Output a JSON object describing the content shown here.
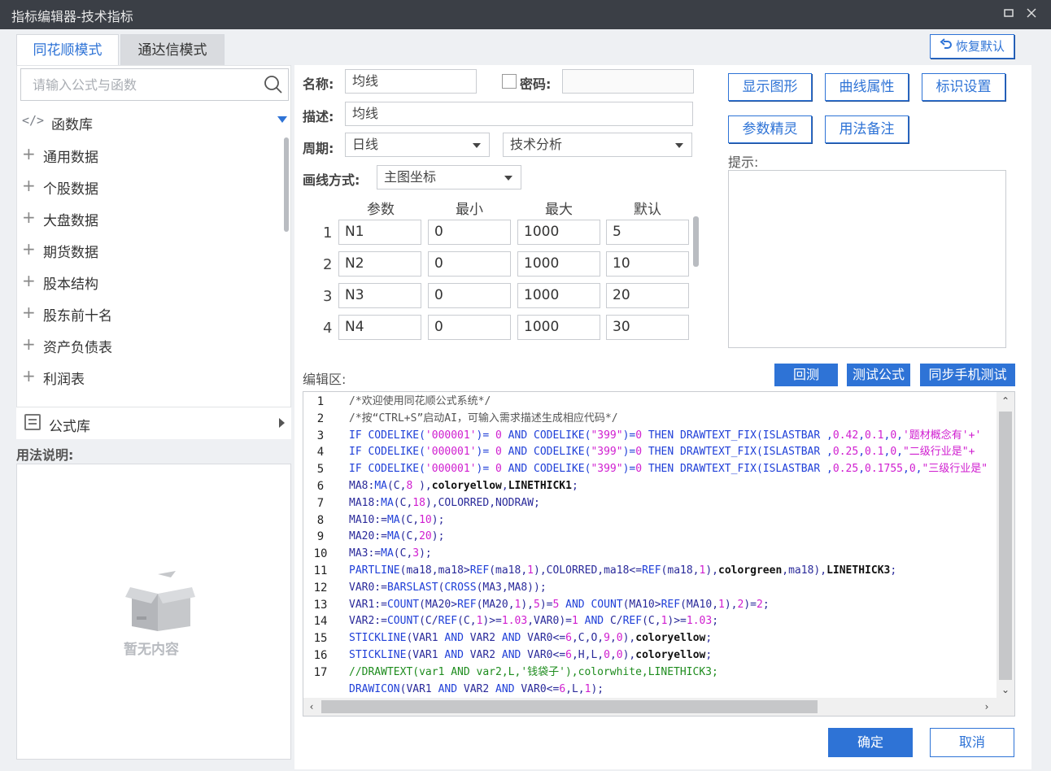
{
  "window": {
    "title": "指标编辑器-技术指标"
  },
  "tabs": {
    "ths": "同花顺模式",
    "tdx": "通达信模式"
  },
  "restore_default": "恢复默认",
  "search": {
    "placeholder": "请输入公式与函数"
  },
  "library": {
    "label": "函数库",
    "items": [
      "通用数据",
      "个股数据",
      "大盘数据",
      "期货数据",
      "股本结构",
      "股东前十名",
      "资产负债表",
      "利润表"
    ],
    "formula_lib": "公式库"
  },
  "usage": {
    "label": "用法说明:",
    "empty": "暂无内容"
  },
  "form": {
    "name_label": "名称:",
    "name_value": "均线",
    "password_label": "密码:",
    "desc_label": "描述:",
    "desc_value": "均线",
    "period_label": "周期:",
    "period_value": "日线",
    "category_value": "技术分析",
    "draw_label": "画线方式:",
    "draw_value": "主图坐标"
  },
  "params": {
    "headers": {
      "param": "参数",
      "min": "最小",
      "max": "最大",
      "default": "默认"
    },
    "rows": [
      {
        "num": "1",
        "name": "N1",
        "min": "0",
        "max": "1000",
        "def": "5"
      },
      {
        "num": "2",
        "name": "N2",
        "min": "0",
        "max": "1000",
        "def": "10"
      },
      {
        "num": "3",
        "name": "N3",
        "min": "0",
        "max": "1000",
        "def": "20"
      },
      {
        "num": "4",
        "name": "N4",
        "min": "0",
        "max": "1000",
        "def": "30"
      }
    ]
  },
  "buttons": {
    "show_graph": "显示图形",
    "curve_props": "曲线属性",
    "mark_settings": "标识设置",
    "param_wizard": "参数精灵",
    "usage_notes": "用法备注",
    "backtest": "回测",
    "test_formula": "测试公式",
    "sync_mobile": "同步手机测试",
    "ok": "确定",
    "cancel": "取消"
  },
  "hint_label": "提示:",
  "editor_label": "编辑区:",
  "editor": {
    "line_numbers": [
      "1",
      "2",
      "3",
      "4",
      "5",
      "6",
      "7",
      "8",
      "9",
      "10",
      "11",
      "12",
      "13",
      "14",
      "15",
      "16",
      "17"
    ],
    "lines": [
      [
        [
          "c-gray",
          "/*欢迎使用同花顺公式系统*/"
        ]
      ],
      [
        [
          "c-gray",
          "/*按“CTRL+S”启动AI，可输入需求描述生成相应代码*/"
        ]
      ],
      [
        [
          "c-blue",
          "IF CODELIKE("
        ],
        [
          "c-mag",
          "'000001'"
        ],
        [
          "c-blue",
          ")= "
        ],
        [
          "c-mag",
          "0"
        ],
        [
          "c-blue",
          " AND CODELIKE("
        ],
        [
          "c-mag",
          "\"399\""
        ],
        [
          "c-blue",
          ")="
        ],
        [
          "c-mag",
          "0"
        ],
        [
          "c-blue",
          " THEN DRAWTEXT_FIX(ISLASTBAR ,"
        ],
        [
          "c-mag",
          "0.42"
        ],
        [
          "c-blue",
          ","
        ],
        [
          "c-mag",
          "0.1"
        ],
        [
          "c-blue",
          ","
        ],
        [
          "c-mag",
          "0"
        ],
        [
          "c-blue",
          ","
        ],
        [
          "c-mag",
          "'题材概念有'+'"
        ]
      ],
      [
        [
          "c-blue",
          "IF CODELIKE("
        ],
        [
          "c-mag",
          "'000001'"
        ],
        [
          "c-blue",
          ")= "
        ],
        [
          "c-mag",
          "0"
        ],
        [
          "c-blue",
          " AND CODELIKE("
        ],
        [
          "c-mag",
          "\"399\""
        ],
        [
          "c-blue",
          ")="
        ],
        [
          "c-mag",
          "0"
        ],
        [
          "c-blue",
          " THEN DRAWTEXT_FIX(ISLASTBAR ,"
        ],
        [
          "c-mag",
          "0.25"
        ],
        [
          "c-blue",
          ","
        ],
        [
          "c-mag",
          "0.1"
        ],
        [
          "c-blue",
          ","
        ],
        [
          "c-mag",
          "0"
        ],
        [
          "c-blue",
          ","
        ],
        [
          "c-mag",
          "\"二级行业是\"+"
        ]
      ],
      [
        [
          "c-blue",
          "IF CODELIKE("
        ],
        [
          "c-mag",
          "'000001'"
        ],
        [
          "c-blue",
          ")= "
        ],
        [
          "c-mag",
          "0"
        ],
        [
          "c-blue",
          " AND CODELIKE("
        ],
        [
          "c-mag",
          "\"399\""
        ],
        [
          "c-blue",
          ")="
        ],
        [
          "c-mag",
          "0"
        ],
        [
          "c-blue",
          " THEN DRAWTEXT_FIX(ISLASTBAR ,"
        ],
        [
          "c-mag",
          "0.25"
        ],
        [
          "c-blue",
          ","
        ],
        [
          "c-mag",
          "0.1755"
        ],
        [
          "c-blue",
          ","
        ],
        [
          "c-mag",
          "0"
        ],
        [
          "c-blue",
          ","
        ],
        [
          "c-mag",
          "\"三级行业是\""
        ]
      ],
      [
        [
          "c-dblue",
          "MA8:"
        ],
        [
          "c-blue",
          "MA"
        ],
        [
          "c-dblue",
          "(C,"
        ],
        [
          "c-mag",
          "8"
        ],
        [
          "c-dblue",
          " ),"
        ],
        [
          "c-blk",
          "coloryellow"
        ],
        [
          "c-dblue",
          ","
        ],
        [
          "c-blk",
          "LINETHICK1"
        ],
        [
          "c-dblue",
          ";"
        ]
      ],
      [
        [
          "c-dblue",
          "MA18:"
        ],
        [
          "c-blue",
          "MA"
        ],
        [
          "c-dblue",
          "(C,"
        ],
        [
          "c-mag",
          "18"
        ],
        [
          "c-dblue",
          "),COLORRED,NODRAW;"
        ]
      ],
      [
        [
          "c-dblue",
          "MA10:="
        ],
        [
          "c-blue",
          "MA"
        ],
        [
          "c-dblue",
          "(C,"
        ],
        [
          "c-mag",
          "10"
        ],
        [
          "c-dblue",
          ");"
        ]
      ],
      [
        [
          "c-dblue",
          "MA20:="
        ],
        [
          "c-blue",
          "MA"
        ],
        [
          "c-dblue",
          "(C,"
        ],
        [
          "c-mag",
          "20"
        ],
        [
          "c-dblue",
          ");"
        ]
      ],
      [
        [
          "c-dblue",
          "MA3:="
        ],
        [
          "c-blue",
          "MA"
        ],
        [
          "c-dblue",
          "(C,"
        ],
        [
          "c-mag",
          "3"
        ],
        [
          "c-dblue",
          ");"
        ]
      ],
      [
        [
          "c-blue",
          "PARTLINE"
        ],
        [
          "c-dblue",
          "(ma18,ma18>"
        ],
        [
          "c-blue",
          "REF"
        ],
        [
          "c-dblue",
          "(ma18,"
        ],
        [
          "c-mag",
          "1"
        ],
        [
          "c-dblue",
          "),COLORRED,ma18<="
        ],
        [
          "c-blue",
          "REF"
        ],
        [
          "c-dblue",
          "(ma18,"
        ],
        [
          "c-mag",
          "1"
        ],
        [
          "c-dblue",
          "),"
        ],
        [
          "c-blk",
          "colorgreen"
        ],
        [
          "c-dblue",
          ",ma18),"
        ],
        [
          "c-blk",
          "LINETHICK3"
        ],
        [
          "c-dblue",
          ";"
        ]
      ],
      [
        [
          "c-dblue",
          "VAR0:="
        ],
        [
          "c-blue",
          "BARSLAST"
        ],
        [
          "c-dblue",
          "("
        ],
        [
          "c-blue",
          "CROSS"
        ],
        [
          "c-dblue",
          "(MA3,MA8));"
        ]
      ],
      [
        [
          "c-dblue",
          "VAR1:="
        ],
        [
          "c-blue",
          "COUNT"
        ],
        [
          "c-dblue",
          "(MA20>"
        ],
        [
          "c-blue",
          "REF"
        ],
        [
          "c-dblue",
          "(MA20,"
        ],
        [
          "c-mag",
          "1"
        ],
        [
          "c-dblue",
          "),"
        ],
        [
          "c-mag",
          "5"
        ],
        [
          "c-dblue",
          ")="
        ],
        [
          "c-mag",
          "5"
        ],
        [
          "c-blue",
          " AND COUNT"
        ],
        [
          "c-dblue",
          "(MA10>"
        ],
        [
          "c-blue",
          "REF"
        ],
        [
          "c-dblue",
          "(MA10,"
        ],
        [
          "c-mag",
          "1"
        ],
        [
          "c-dblue",
          "),"
        ],
        [
          "c-mag",
          "2"
        ],
        [
          "c-dblue",
          ")="
        ],
        [
          "c-mag",
          "2"
        ],
        [
          "c-dblue",
          ";"
        ]
      ],
      [
        [
          "c-dblue",
          "VAR2:="
        ],
        [
          "c-blue",
          "COUNT"
        ],
        [
          "c-dblue",
          "(C/"
        ],
        [
          "c-blue",
          "REF"
        ],
        [
          "c-dblue",
          "(C,"
        ],
        [
          "c-mag",
          "1"
        ],
        [
          "c-dblue",
          ")>="
        ],
        [
          "c-mag",
          "1.03"
        ],
        [
          "c-dblue",
          ",VAR0)="
        ],
        [
          "c-mag",
          "1"
        ],
        [
          "c-blue",
          " AND "
        ],
        [
          "c-dblue",
          "C/"
        ],
        [
          "c-blue",
          "REF"
        ],
        [
          "c-dblue",
          "(C,"
        ],
        [
          "c-mag",
          "1"
        ],
        [
          "c-dblue",
          ")>="
        ],
        [
          "c-mag",
          "1.03"
        ],
        [
          "c-dblue",
          ";"
        ]
      ],
      [
        [
          "c-blue",
          "STICKLINE"
        ],
        [
          "c-dblue",
          "(VAR1 "
        ],
        [
          "c-blue",
          "AND"
        ],
        [
          "c-dblue",
          " VAR2 "
        ],
        [
          "c-blue",
          "AND"
        ],
        [
          "c-dblue",
          " VAR0<="
        ],
        [
          "c-mag",
          "6"
        ],
        [
          "c-dblue",
          ",C,O,"
        ],
        [
          "c-mag",
          "9"
        ],
        [
          "c-dblue",
          ","
        ],
        [
          "c-mag",
          "0"
        ],
        [
          "c-dblue",
          "),"
        ],
        [
          "c-blk",
          "coloryellow"
        ],
        [
          "c-dblue",
          ";"
        ]
      ],
      [
        [
          "c-blue",
          "STICKLINE"
        ],
        [
          "c-dblue",
          "(VAR1 "
        ],
        [
          "c-blue",
          "AND"
        ],
        [
          "c-dblue",
          " VAR2 "
        ],
        [
          "c-blue",
          "AND"
        ],
        [
          "c-dblue",
          " VAR0<="
        ],
        [
          "c-mag",
          "6"
        ],
        [
          "c-dblue",
          ",H,L,"
        ],
        [
          "c-mag",
          "0"
        ],
        [
          "c-dblue",
          ","
        ],
        [
          "c-mag",
          "0"
        ],
        [
          "c-dblue",
          "),"
        ],
        [
          "c-blk",
          "coloryellow"
        ],
        [
          "c-dblue",
          ";"
        ]
      ],
      [
        [
          "c-green",
          "//DRAWTEXT(var1 AND var2,L,'钱袋子'),colorwhite,LINETHICK3;"
        ]
      ],
      [
        [
          "c-blue",
          "DRAWICON"
        ],
        [
          "c-dblue",
          "(VAR1 "
        ],
        [
          "c-blue",
          "AND"
        ],
        [
          "c-dblue",
          " VAR2 "
        ],
        [
          "c-blue",
          "AND"
        ],
        [
          "c-dblue",
          " VAR0<="
        ],
        [
          "c-mag",
          "6"
        ],
        [
          "c-dblue",
          ",L,"
        ],
        [
          "c-mag",
          "1"
        ],
        [
          "c-dblue",
          ");"
        ]
      ]
    ]
  }
}
